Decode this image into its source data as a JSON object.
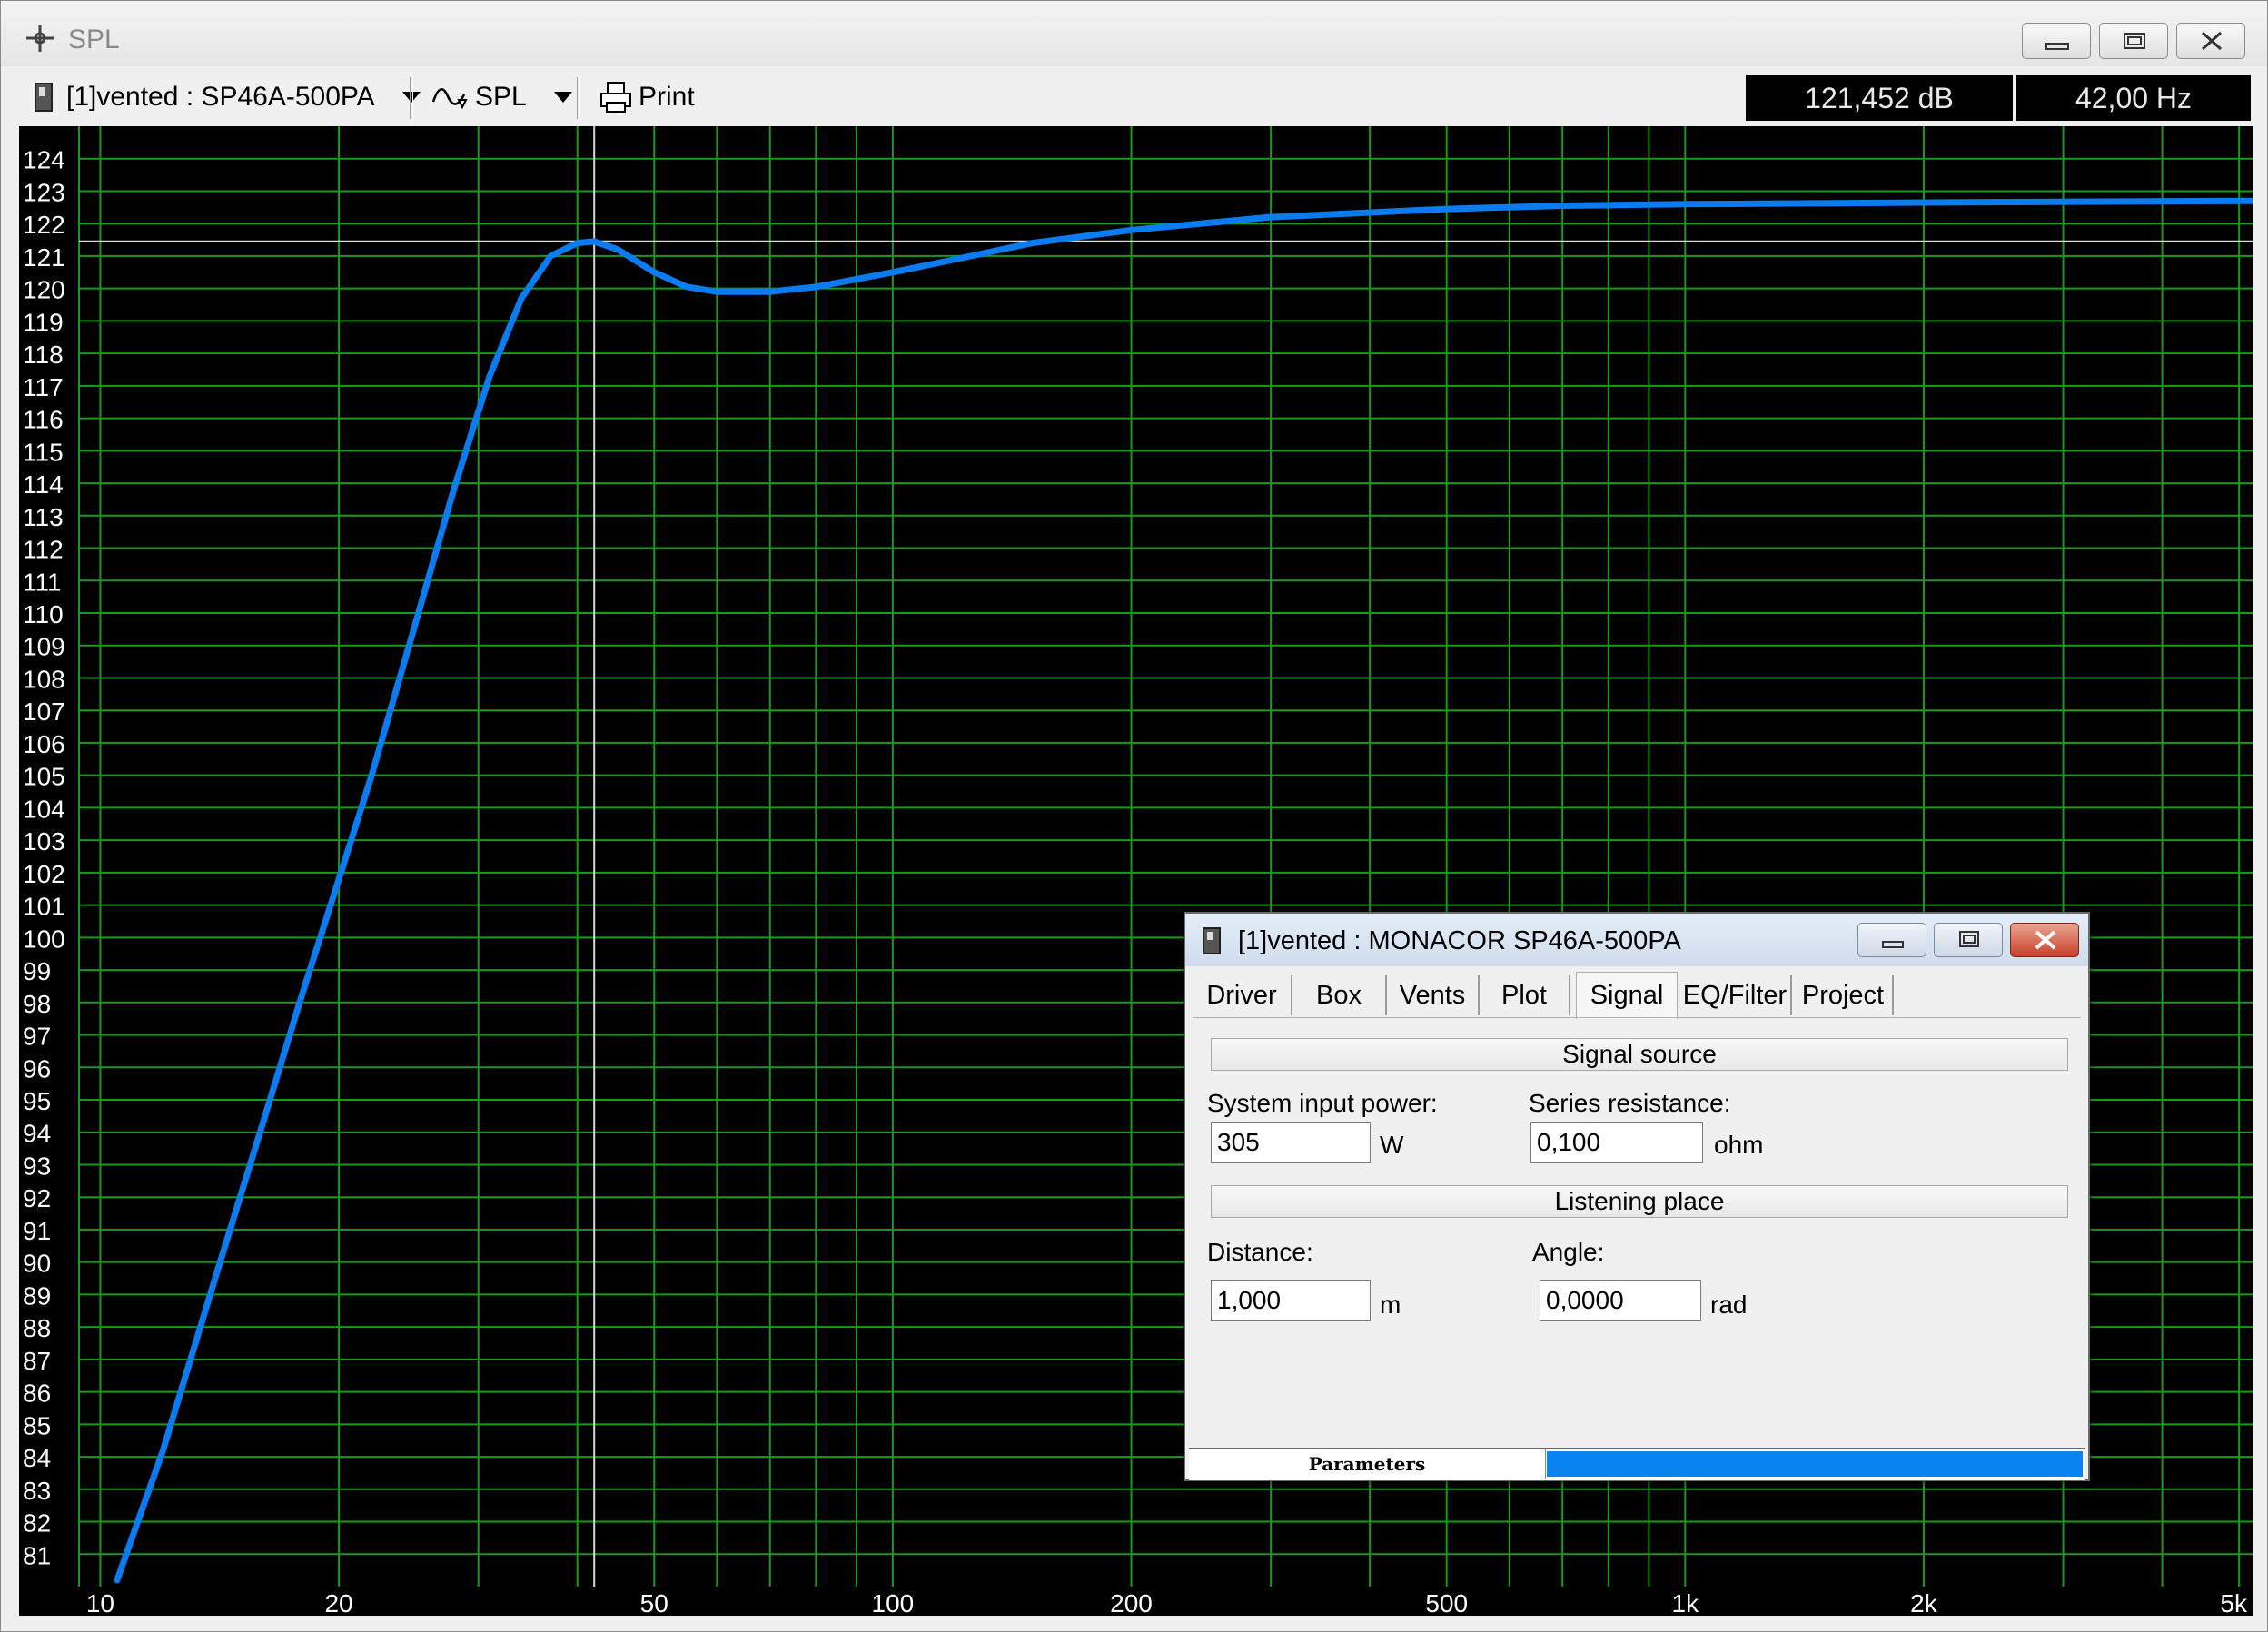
{
  "window": {
    "title": "SPL"
  },
  "toolbar": {
    "project_selector": "[1]vented : SP46A-500PA",
    "plot_selector": "SPL",
    "print_label": "Print"
  },
  "readouts": {
    "level": "121,452 dB",
    "frequency": "42,00 Hz"
  },
  "chart_data": {
    "type": "line",
    "x_scale": "log",
    "xlim": [
      9.4,
      5200
    ],
    "ylim": [
      80,
      125
    ],
    "x_tick_labels": [
      {
        "value": 10,
        "label": "10"
      },
      {
        "value": 20,
        "label": "20"
      },
      {
        "value": 50,
        "label": "50"
      },
      {
        "value": 100,
        "label": "100"
      },
      {
        "value": 200,
        "label": "200"
      },
      {
        "value": 500,
        "label": "500"
      },
      {
        "value": 1000,
        "label": "1k"
      },
      {
        "value": 2000,
        "label": "2k"
      },
      {
        "value": 5000,
        "label": "5k"
      }
    ],
    "y_ticks": [
      81,
      82,
      83,
      84,
      85,
      86,
      87,
      88,
      89,
      90,
      91,
      92,
      93,
      94,
      95,
      96,
      97,
      98,
      99,
      100,
      101,
      102,
      103,
      104,
      105,
      106,
      107,
      108,
      109,
      110,
      111,
      112,
      113,
      114,
      115,
      116,
      117,
      118,
      119,
      120,
      121,
      122,
      123,
      124
    ],
    "grid": true,
    "cursor": {
      "x": 42,
      "y": 121.452
    },
    "series": [
      {
        "color": "#0a7cf0",
        "x": [
          10.5,
          12,
          14,
          16,
          18,
          20,
          22,
          25,
          28,
          31,
          34,
          37,
          40,
          42,
          45,
          50,
          55,
          60,
          70,
          80,
          100,
          120,
          150,
          200,
          300,
          500,
          700,
          1000,
          2000,
          5200
        ],
        "y": [
          80.2,
          84.2,
          89.6,
          94.2,
          98.3,
          101.8,
          105.0,
          109.7,
          113.9,
          117.3,
          119.7,
          121.0,
          121.4,
          121.45,
          121.2,
          120.5,
          120.05,
          119.9,
          119.9,
          120.05,
          120.5,
          120.9,
          121.4,
          121.8,
          122.2,
          122.45,
          122.55,
          122.6,
          122.65,
          122.7
        ]
      }
    ]
  },
  "dialog": {
    "title": "[1]vented : MONACOR SP46A-500PA",
    "tabs": [
      {
        "label": "Driver"
      },
      {
        "label": "Box"
      },
      {
        "label": "Vents"
      },
      {
        "label": "Plot"
      },
      {
        "label": "Signal"
      },
      {
        "label": "EQ/Filter"
      },
      {
        "label": "Project"
      }
    ],
    "active_tab": "Signal",
    "signal_source": {
      "header": "Signal source",
      "power_label": "System input power:",
      "power_value": "305",
      "power_unit": "W",
      "resistance_label": "Series resistance:",
      "resistance_value": "0,100",
      "resistance_unit": "ohm"
    },
    "listening_place": {
      "header": "Listening place",
      "distance_label": "Distance:",
      "distance_value": "1,000",
      "distance_unit": "m",
      "angle_label": "Angle:",
      "angle_value": "0,0000",
      "angle_unit": "rad"
    },
    "status": {
      "label": "Parameters",
      "progress": 1.0
    }
  }
}
